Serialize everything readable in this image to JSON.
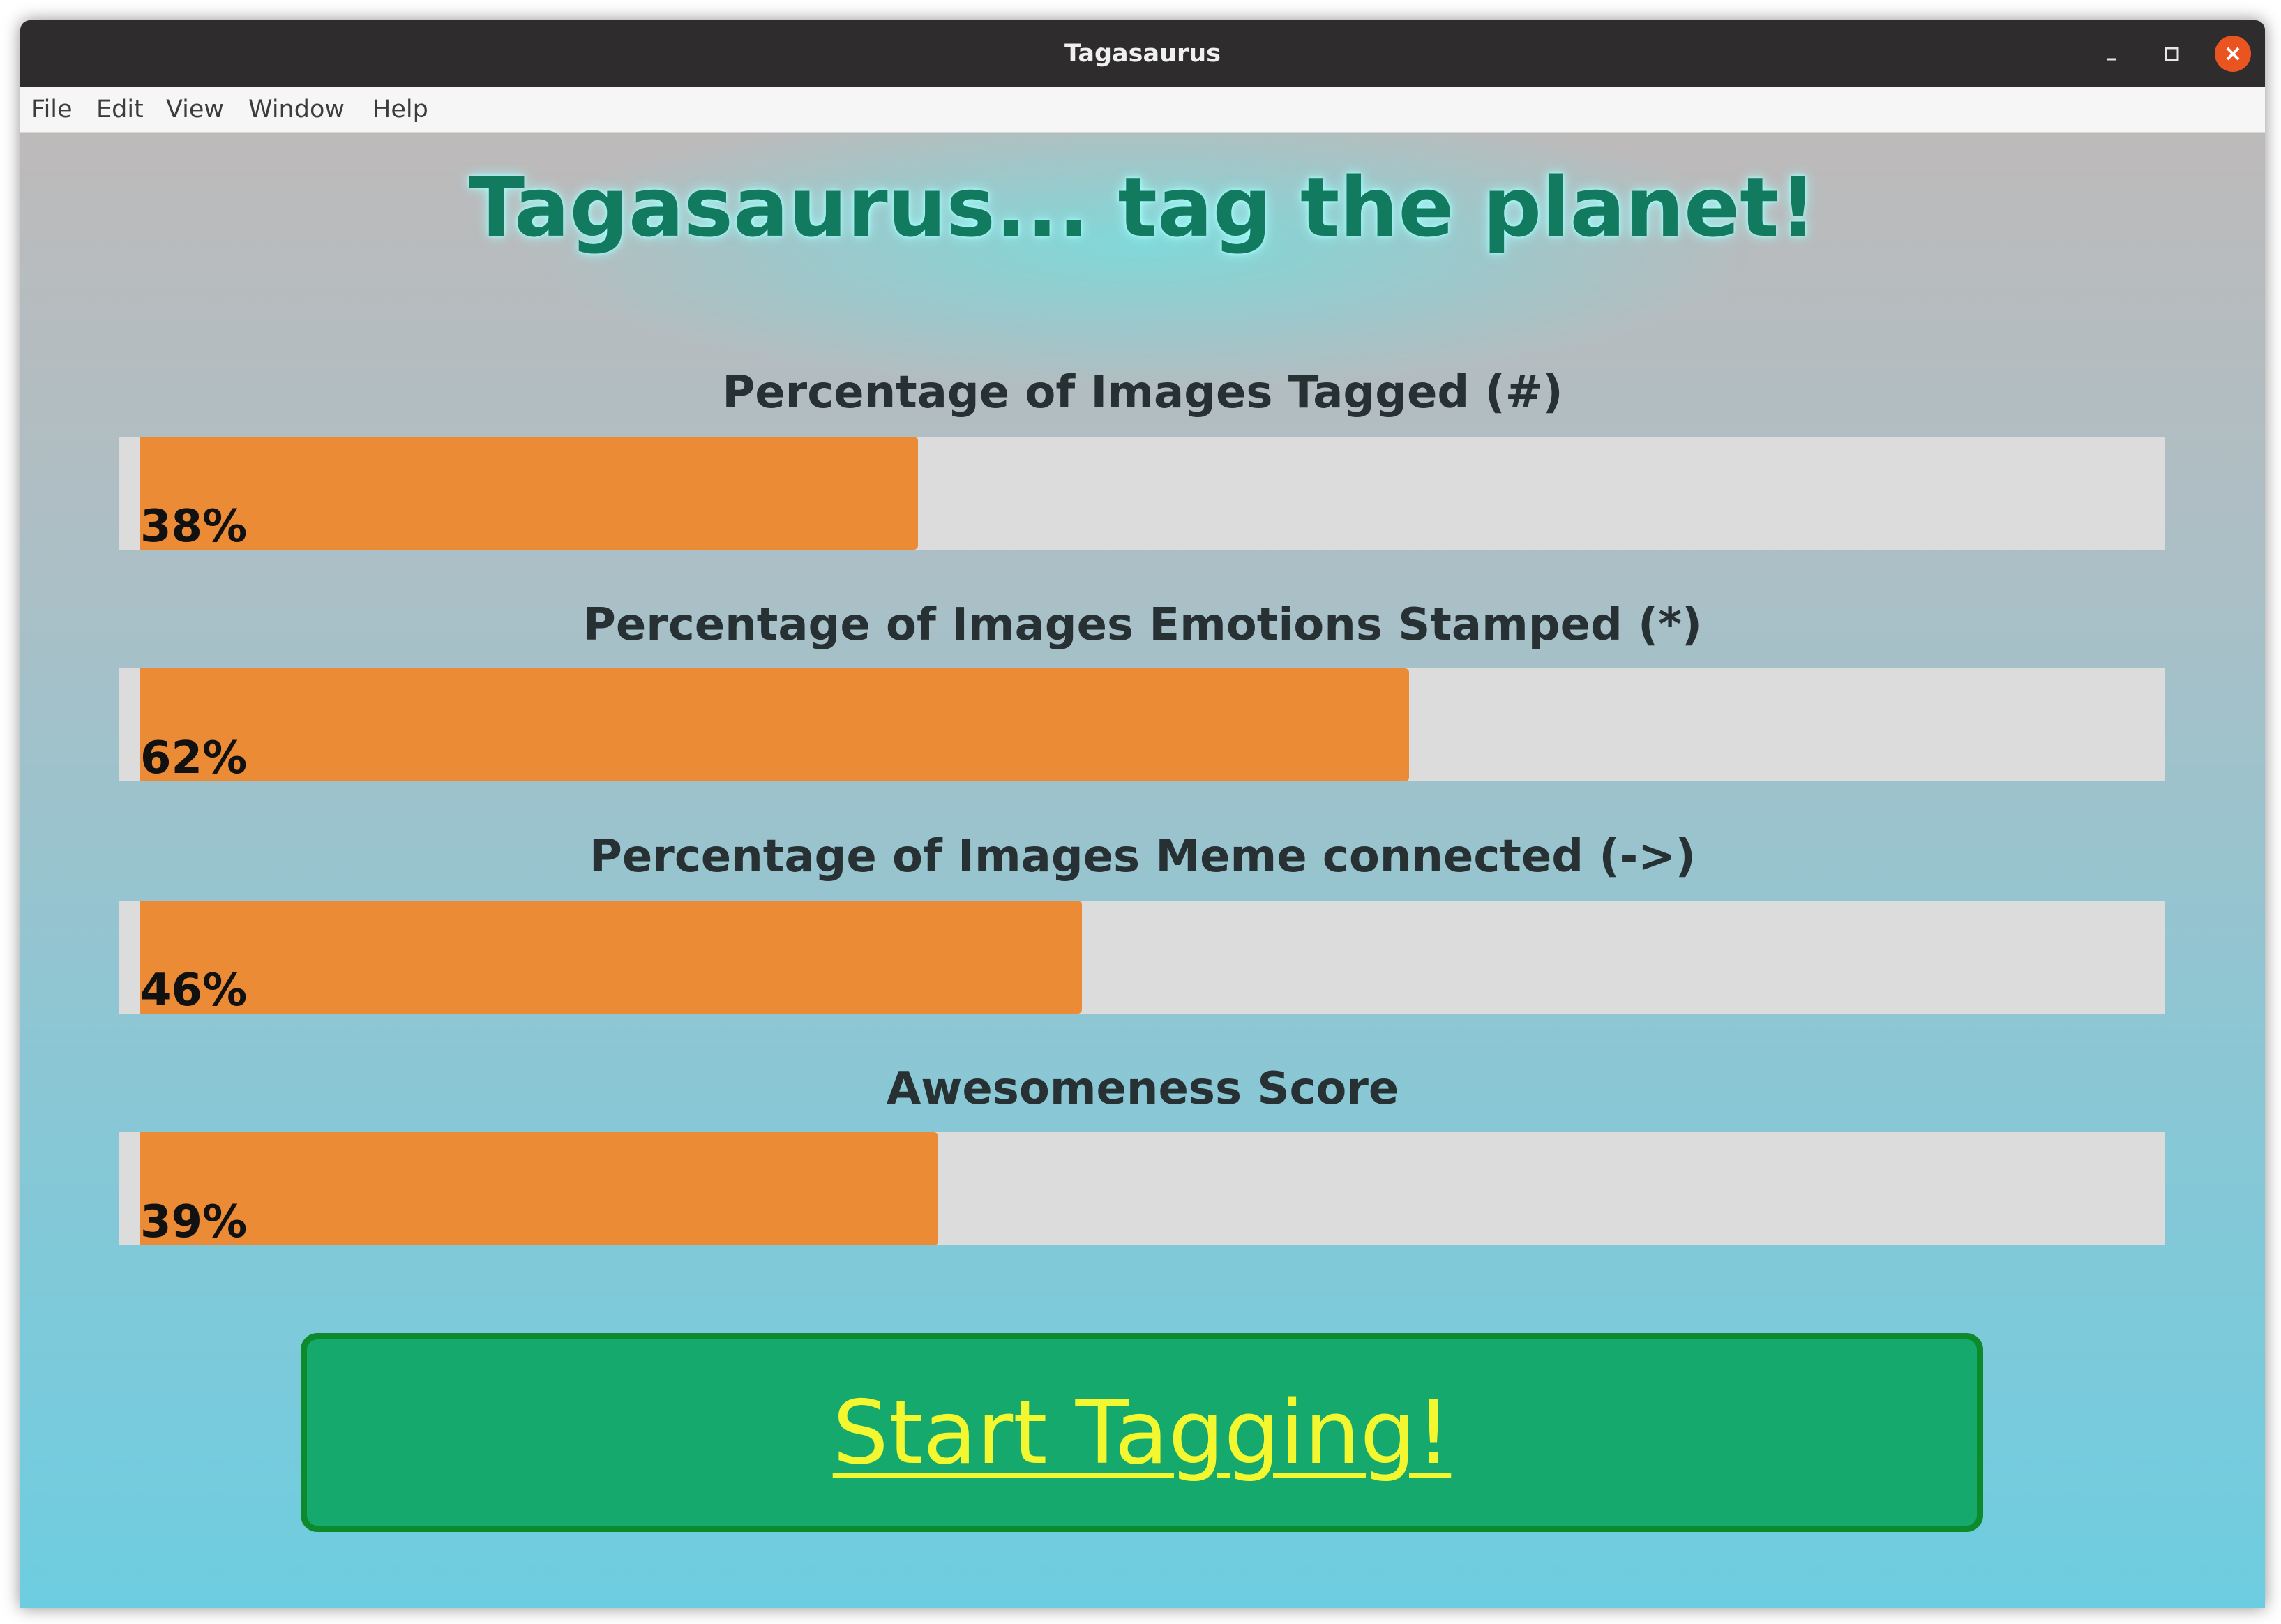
{
  "window": {
    "title": "Tagasaurus"
  },
  "menubar": {
    "items": [
      {
        "label": "File"
      },
      {
        "label": "Edit"
      },
      {
        "label": "View"
      },
      {
        "label": "Window"
      },
      {
        "label": "Help"
      }
    ]
  },
  "main": {
    "headline": "Tagasaurus... tag the planet!",
    "stats": [
      {
        "label": "Percentage of Images Tagged (#)",
        "percent": 38,
        "display": "38%"
      },
      {
        "label": "Percentage of Images Emotions Stamped (*)",
        "percent": 62,
        "display": "62%"
      },
      {
        "label": "Percentage of Images Meme connected (->)",
        "percent": 46,
        "display": "46%"
      },
      {
        "label": "Awesomeness Score",
        "percent": 39,
        "display": "39%"
      }
    ],
    "start_button_label": "Start Tagging!"
  },
  "colors": {
    "progress_fill": "#eb8b36",
    "progress_track": "#dcdcdc",
    "button_bg": "#16a96e",
    "button_border": "#0d8a2b",
    "button_text": "#f3f72f",
    "headline": "#127a5f",
    "close_button": "#e95420"
  },
  "icons": {
    "minimize": "minimize-icon",
    "maximize": "maximize-icon",
    "close": "close-icon"
  }
}
